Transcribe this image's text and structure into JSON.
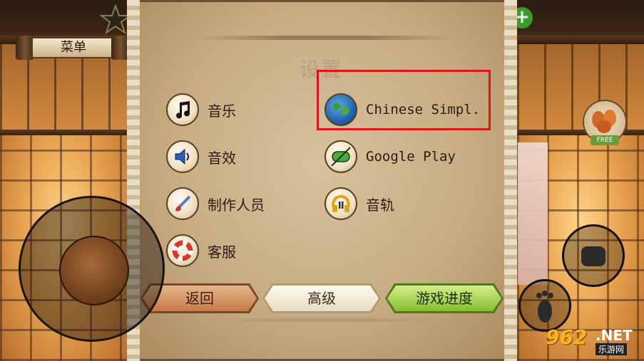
{
  "hud": {
    "menu_label": "菜单",
    "plus_symbol": "+",
    "free_badge": "FREE"
  },
  "settings": {
    "title": "设置",
    "options_left": [
      {
        "label": "音乐",
        "icon": "music-note-icon"
      },
      {
        "label": "音效",
        "icon": "speaker-icon"
      },
      {
        "label": "制作人员",
        "icon": "paintbrush-icon"
      },
      {
        "label": "客服",
        "icon": "lifebuoy-icon"
      }
    ],
    "options_right": [
      {
        "label": "Chinese Simpl.",
        "icon": "globe-icon"
      },
      {
        "label": "Google Play",
        "icon": "gamepad-icon"
      },
      {
        "label": "音轨",
        "icon": "headphones-icon"
      }
    ],
    "buttons": {
      "back": "返回",
      "advanced": "高级",
      "progress": "游戏进度"
    }
  },
  "watermark": {
    "number": "962",
    "net": ".NET",
    "site": "乐游网"
  },
  "colors": {
    "highlight": "#e01616",
    "progress_button": "#86bd2f",
    "back_button": "#c57b4a"
  }
}
